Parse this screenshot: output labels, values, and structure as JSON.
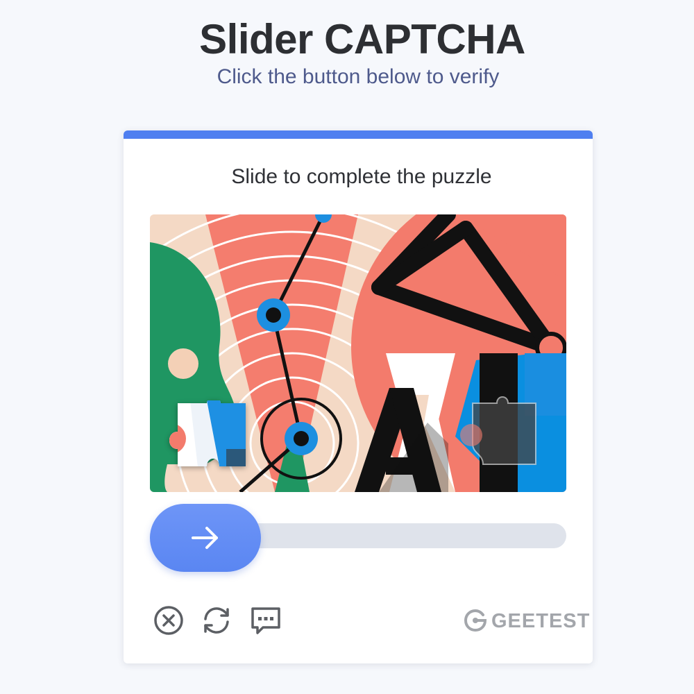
{
  "header": {
    "title": "Slider CAPTCHA",
    "subtitle": "Click the button below to verify"
  },
  "captcha": {
    "instruction": "Slide to complete the puzzle",
    "accent_color": "#4f7ff0",
    "slider": {
      "handle_icon": "arrow-right-icon",
      "progress": 0
    },
    "toolbar": {
      "close_icon": "close-icon",
      "refresh_icon": "refresh-icon",
      "feedback_icon": "feedback-icon"
    },
    "brand": "GEETEST"
  }
}
